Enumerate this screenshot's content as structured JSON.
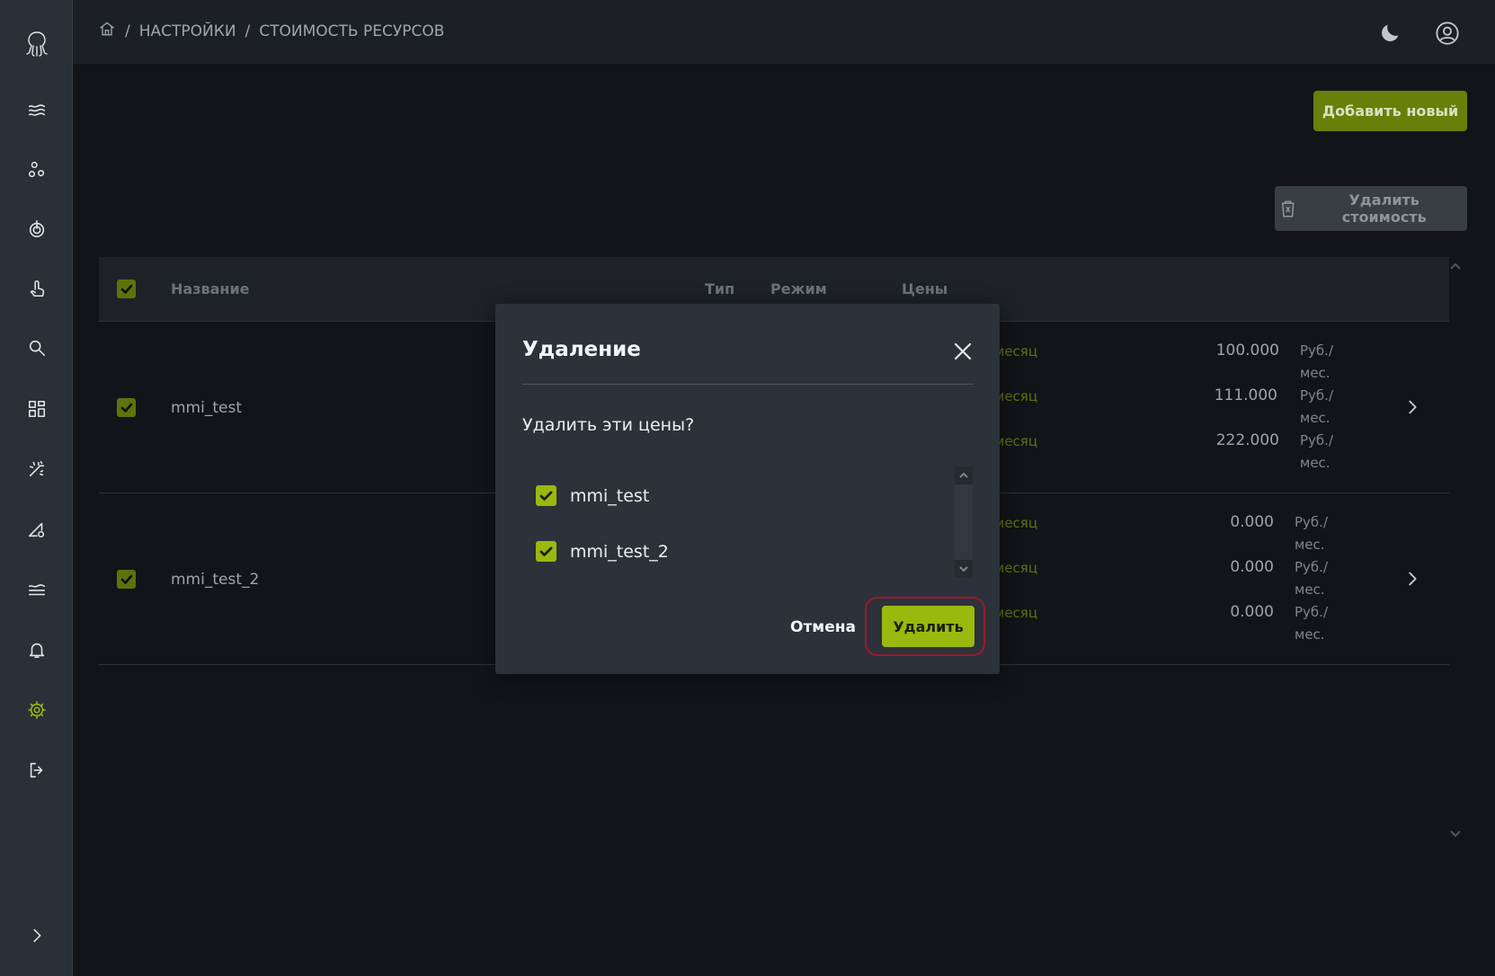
{
  "breadcrumb": {
    "items": [
      "НАСТРОЙКИ",
      "СТОИМОСТЬ РЕСУРСОВ"
    ],
    "separator": "/"
  },
  "toolbar": {
    "add_label": "Добавить новый",
    "delete_cost_label": "Удалить стоимость"
  },
  "table": {
    "columns": [
      "Название",
      "Тип",
      "Режим",
      "Цены"
    ],
    "rows": [
      {
        "name": "mmi_test",
        "periods": [
          "месяц",
          "месяц",
          "месяц"
        ],
        "prices": [
          "100.000",
          "111.000",
          "222.000"
        ],
        "unit": "Руб./мес."
      },
      {
        "name": "mmi_test_2",
        "periods": [
          "месяц",
          "месяц",
          "месяц"
        ],
        "prices": [
          "0.000",
          "0.000",
          "0.000"
        ],
        "unit": "Руб./мес."
      }
    ]
  },
  "modal": {
    "title": "Удаление",
    "question": "Удалить эти цены?",
    "items": [
      "mmi_test",
      "mmi_test_2"
    ],
    "cancel_label": "Отмена",
    "confirm_label": "Удалить"
  },
  "colors": {
    "accent": "#9bb80e",
    "highlight_ring": "#9a1b2c",
    "background": "#121419"
  }
}
